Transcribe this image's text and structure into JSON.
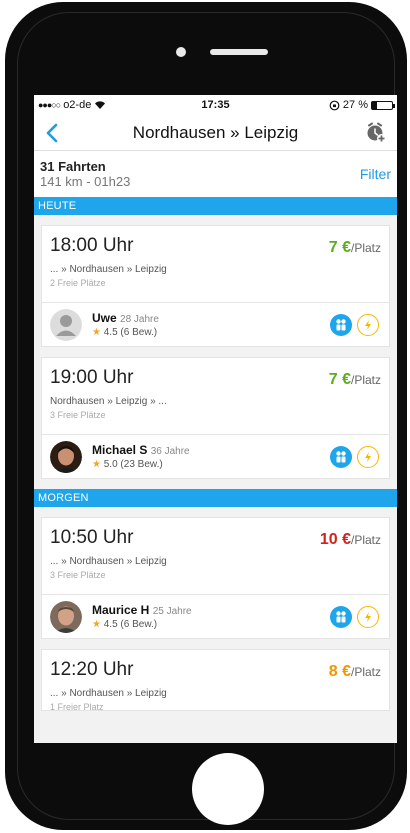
{
  "status_bar": {
    "carrier": "o2-de",
    "time": "17:35",
    "battery_text": "27 %",
    "battery_level": 0.27
  },
  "nav": {
    "title": "Nordhausen » Leipzig",
    "back_icon": "chevron-left-icon",
    "action_icon": "alarm-add-icon"
  },
  "summary": {
    "count": "31 Fahrten",
    "meta": "141 km - 01h23",
    "filter_label": "Filter"
  },
  "colors": {
    "accent": "#1ea5ec",
    "price_green": "#5aae1b",
    "price_red": "#d0231d",
    "price_orange": "#f29600",
    "star": "#f5a623"
  },
  "sections": [
    {
      "header": "HEUTE",
      "rides": [
        {
          "time": "18:00 Uhr",
          "price": "7 €",
          "price_unit": "/Platz",
          "price_color": "#5aae1b",
          "route": "... » Nordhausen » Leipzig",
          "seats": "2 Freie Plätze",
          "driver": {
            "name": "Uwe",
            "age": "28 Jahre",
            "rating": "4.5 (6 Bew.)",
            "avatar": "placeholder"
          }
        },
        {
          "time": "19:00 Uhr",
          "price": "7 €",
          "price_unit": "/Platz",
          "price_color": "#5aae1b",
          "route": "Nordhausen » Leipzig » ...",
          "seats": "3 Freie Plätze",
          "driver": {
            "name": "Michael S",
            "age": "36 Jahre",
            "rating": "5.0 (23 Bew.)",
            "avatar": "photo"
          }
        }
      ]
    },
    {
      "header": "MORGEN",
      "rides": [
        {
          "time": "10:50 Uhr",
          "price": "10 €",
          "price_unit": "/Platz",
          "price_color": "#d0231d",
          "route": "... » Nordhausen » Leipzig",
          "seats": "3 Freie Plätze",
          "driver": {
            "name": "Maurice H",
            "age": "25 Jahre",
            "rating": "4.5 (6 Bew.)",
            "avatar": "photo"
          }
        },
        {
          "time": "12:20 Uhr",
          "price": "8 €",
          "price_unit": "/Platz",
          "price_color": "#f29600",
          "route": "... » Nordhausen » Leipzig",
          "seats": "1 Freier Platz"
        }
      ]
    }
  ]
}
